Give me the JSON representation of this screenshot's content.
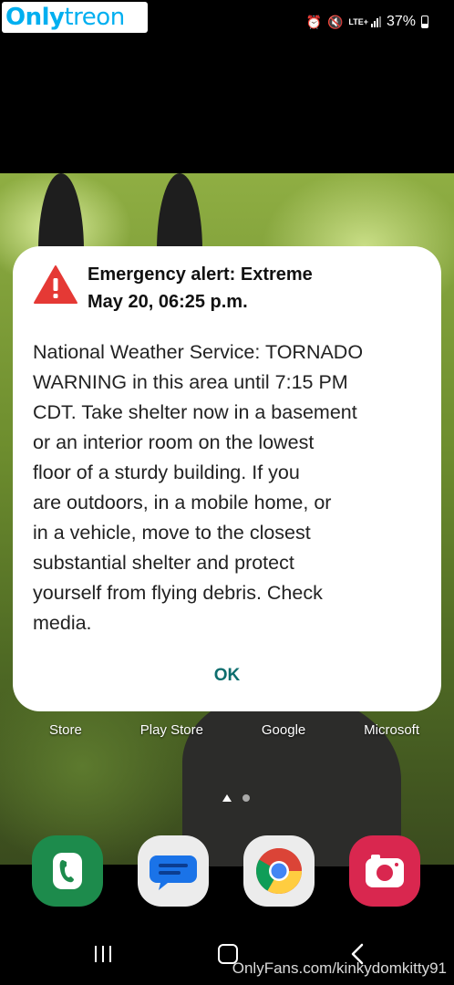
{
  "watermark": {
    "logo_part1": "Only",
    "logo_part2": "treon",
    "footer": "OnlyFans.com/kinkydomkitty91"
  },
  "status_bar": {
    "network": "LTE+",
    "battery": "37%",
    "icons": [
      "alarm-icon",
      "mute-icon",
      "lte-icon",
      "signal-icon",
      "battery-icon"
    ]
  },
  "alert": {
    "title_line1": "Emergency alert: Extreme",
    "title_line2": "May 20, 06:25 p.m.",
    "body_lines": [
      "National Weather Service: TORNADO",
      "WARNING in this area until 7:15 PM",
      "CDT. Take shelter now in a basement",
      "or an interior room on the lowest",
      "floor of a sturdy building. If you",
      "are outdoors, in a mobile home, or",
      "in a vehicle, move to the closest",
      "substantial shelter and protect",
      "yourself from flying debris. Check",
      "media."
    ],
    "ok_label": "OK",
    "icon": "warning-triangle-icon",
    "accent_color": "#e53935"
  },
  "home": {
    "app_labels": [
      "Store",
      "Play Store",
      "Google",
      "Microsoft"
    ],
    "dock": [
      {
        "name": "phone",
        "icon": "phone-icon",
        "color": "#1d8b4c"
      },
      {
        "name": "messages",
        "icon": "messages-icon",
        "color": "#1a73e8"
      },
      {
        "name": "chrome",
        "icon": "chrome-icon",
        "color": "#4285f4"
      },
      {
        "name": "camera",
        "icon": "camera-icon",
        "color": "#d9274f"
      }
    ]
  },
  "navbar": {
    "buttons": [
      "recent-apps-button",
      "home-button",
      "back-button"
    ]
  }
}
